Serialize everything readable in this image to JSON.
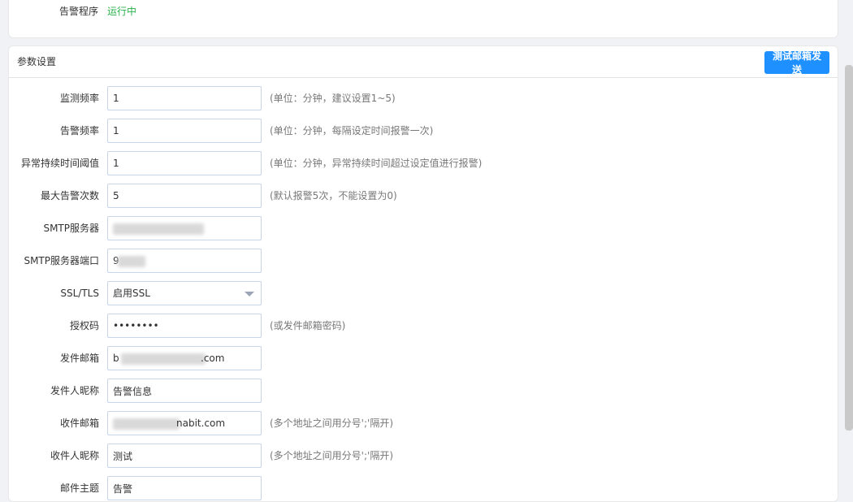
{
  "status": {
    "label": "告警程序",
    "value": "运行中"
  },
  "settings": {
    "title": "参数设置",
    "test_button": "测试邮箱发送",
    "rows": [
      {
        "label": "监测频率",
        "value": "1",
        "hint": "(单位：分钟，建议设置1~5)"
      },
      {
        "label": "告警频率",
        "value": "1",
        "hint": "(单位：分钟，每隔设定时间报警一次)"
      },
      {
        "label": "异常持续时间阈值",
        "value": "1",
        "hint": "(单位：分钟，异常持续时间超过设定值进行报警)"
      },
      {
        "label": "最大告警次数",
        "value": "5",
        "hint": "(默认报警5次，不能设置为0)"
      },
      {
        "label": "SMTP服务器",
        "value": "",
        "hint": ""
      },
      {
        "label": "SMTP服务器端口",
        "value": "9",
        "hint": ""
      },
      {
        "label": "SSL/TLS",
        "value": "启用SSL",
        "hint": ""
      },
      {
        "label": "授权码",
        "value": "••••••••",
        "hint": "(或发件邮箱密码)"
      },
      {
        "label": "发件邮箱",
        "value": "b",
        "value_suffix": ".com",
        "hint": ""
      },
      {
        "label": "发件人昵称",
        "value": "告警信息",
        "hint": ""
      },
      {
        "label": "收件邮箱",
        "value": "",
        "value_suffix": "nabit.com",
        "hint": "(多个地址之间用分号';'隔开)"
      },
      {
        "label": "收件人昵称",
        "value": "测试",
        "hint": "(多个地址之间用分号';'隔开)"
      },
      {
        "label": "邮件主题",
        "value": "告警",
        "hint": ""
      }
    ]
  }
}
